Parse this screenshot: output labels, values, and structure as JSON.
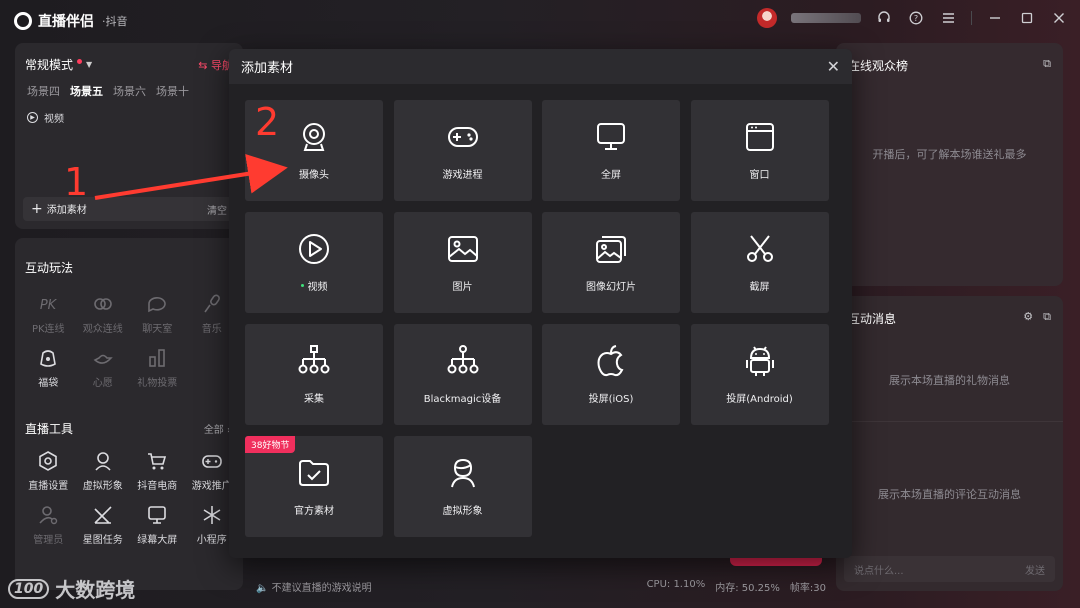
{
  "app": {
    "name": "直播伴侣",
    "platform": "·抖音"
  },
  "left_top": {
    "mode": "常规模式",
    "guide": "导航",
    "scenes": [
      "场景四",
      "场景五",
      "场景六",
      "场景十"
    ],
    "active_scene": "场景五",
    "sources": [
      {
        "label": "视频"
      }
    ],
    "add_label": "添加素材",
    "clear_label": "清空"
  },
  "interactive": {
    "title": "互动玩法",
    "items": [
      {
        "label": "PK连线",
        "icon": "pk-icon",
        "enabled": false
      },
      {
        "label": "观众连线",
        "icon": "link-icon",
        "enabled": false
      },
      {
        "label": "聊天室",
        "icon": "chat-icon",
        "enabled": false
      },
      {
        "label": "音乐",
        "icon": "mic-icon",
        "enabled": false
      },
      {
        "label": "福袋",
        "icon": "luckybag-icon",
        "enabled": true
      },
      {
        "label": "心愿",
        "icon": "lamp-icon",
        "enabled": false
      },
      {
        "label": "礼物投票",
        "icon": "bar-chart-icon",
        "enabled": false
      }
    ]
  },
  "tools": {
    "title": "直播工具",
    "more": "全部",
    "items": [
      {
        "label": "直播设置",
        "icon": "hexagon-settings-icon",
        "enabled": true
      },
      {
        "label": "虚拟形象",
        "icon": "avatar-icon",
        "enabled": true
      },
      {
        "label": "抖音电商",
        "icon": "cart-icon",
        "enabled": true
      },
      {
        "label": "游戏推广",
        "icon": "gamepad-icon",
        "enabled": true
      },
      {
        "label": "管理员",
        "icon": "admin-icon",
        "enabled": false
      },
      {
        "label": "星图任务",
        "icon": "task-icon",
        "enabled": true
      },
      {
        "label": "绿幕大屏",
        "icon": "screen-icon",
        "enabled": true
      },
      {
        "label": "小程序",
        "icon": "miniapp-icon",
        "enabled": true
      }
    ]
  },
  "right_top": {
    "title": "在线观众榜",
    "empty": "开播后，可了解本场谁送礼最多"
  },
  "right_bot": {
    "title": "互动消息",
    "gift_empty": "展示本场直播的礼物消息",
    "comment_empty": "展示本场直播的评论互动消息",
    "input_placeholder": "说点什么...",
    "send_label": "发送"
  },
  "status": {
    "tip": "不建议直播的游戏说明",
    "cpu": "CPU: 1.10%",
    "mem": "内存: 50.25%",
    "fps": "帧率:30"
  },
  "modal": {
    "title": "添加素材",
    "tiles": [
      {
        "label": "摄像头",
        "icon": "camera-icon"
      },
      {
        "label": "游戏进程",
        "icon": "gamepad-icon"
      },
      {
        "label": "全屏",
        "icon": "monitor-icon"
      },
      {
        "label": "窗口",
        "icon": "window-icon"
      },
      {
        "label": "视频",
        "icon": "play-icon",
        "active": true
      },
      {
        "label": "图片",
        "icon": "image-icon"
      },
      {
        "label": "图像幻灯片",
        "icon": "slideshow-icon"
      },
      {
        "label": "截屏",
        "icon": "scissors-icon"
      },
      {
        "label": "采集",
        "icon": "capture-tree-icon"
      },
      {
        "label": "Blackmagic设备",
        "icon": "blackmagic-tree-icon"
      },
      {
        "label": "投屏(iOS)",
        "icon": "apple-icon"
      },
      {
        "label": "投屏(Android)",
        "icon": "android-icon"
      },
      {
        "label": "官方素材",
        "icon": "folder-check-icon",
        "badge": "38好物节"
      },
      {
        "label": "虚拟形象",
        "icon": "avatar-icon"
      }
    ]
  },
  "annotations": {
    "step1": "1",
    "step2": "2",
    "arrow_color": "#ff3b30"
  },
  "watermark": {
    "logo": "100",
    "text": "大数跨境"
  },
  "colors": {
    "accent": "#f02f5d",
    "active_dot": "#3fe07a",
    "modal_bg": "#222124",
    "tile_bg": "#323135"
  }
}
